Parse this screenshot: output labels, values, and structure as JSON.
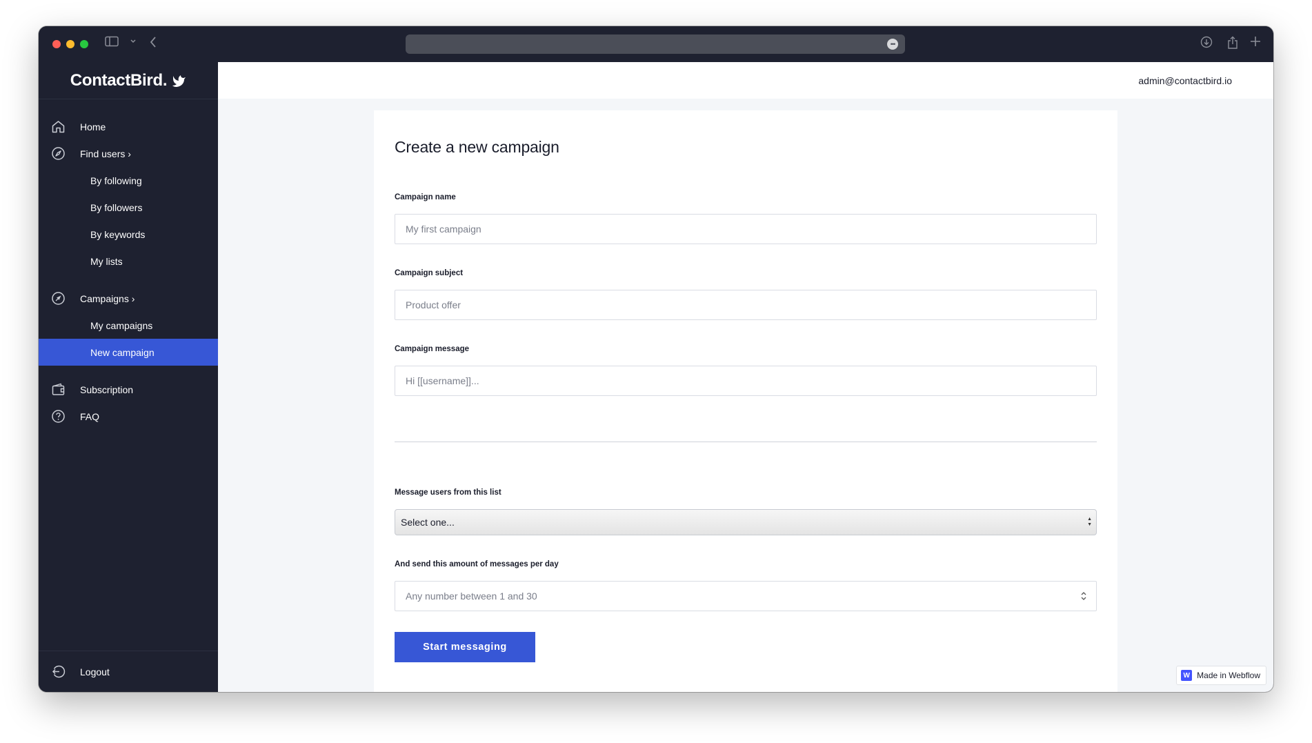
{
  "browser": {
    "tab_icons": [
      "sidebar-toggle-icon",
      "chevron-down-icon",
      "back-icon"
    ],
    "url": "",
    "right_icons": [
      "download-icon",
      "share-icon",
      "new-tab-icon"
    ]
  },
  "sidebar": {
    "brand": "ContactBird.",
    "items": [
      {
        "label": "Home",
        "icon": "home-icon"
      },
      {
        "label": "Find users ›",
        "icon": "compass-icon"
      },
      {
        "label": "By following"
      },
      {
        "label": "By followers"
      },
      {
        "label": "By keywords"
      },
      {
        "label": "My lists"
      },
      {
        "label": "Campaigns ›",
        "icon": "rocket-icon"
      },
      {
        "label": "My campaigns"
      },
      {
        "label": "New campaign",
        "active": true
      },
      {
        "label": "Subscription",
        "icon": "wallet-icon"
      },
      {
        "label": "FAQ",
        "icon": "help-circle-icon"
      }
    ],
    "logout": "Logout",
    "active_color": "#3757d6"
  },
  "header": {
    "user_email": "admin@contactbird.io"
  },
  "form": {
    "title": "Create a new campaign",
    "name_label": "Campaign name",
    "name_placeholder": "My first campaign",
    "subject_label": "Campaign subject",
    "subject_placeholder": "Product offer",
    "message_label": "Campaign message",
    "message_placeholder": "Hi [[username]]...",
    "list_label": "Message users from this list",
    "list_selected": "Select one...",
    "amount_label": "And send this amount of messages per day",
    "amount_placeholder": "Any number between 1 and 30",
    "submit_label": "Start messaging"
  },
  "badge": {
    "text": "Made in Webflow"
  }
}
